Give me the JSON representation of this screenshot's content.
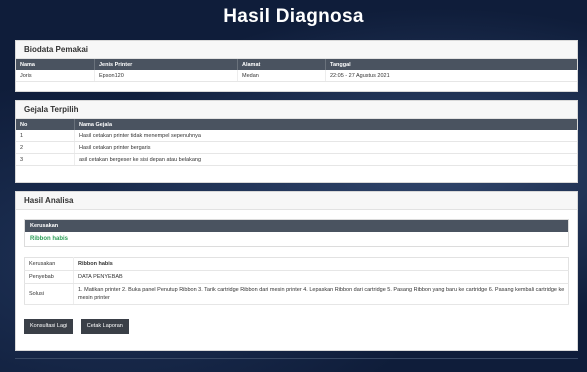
{
  "page": {
    "title": "Hasil Diagnosa"
  },
  "biodata": {
    "heading": "Biodata Pemakai",
    "columns": [
      "Nama",
      "Jenis Printer",
      "Alamat",
      "Tanggal"
    ],
    "row": [
      "Joris",
      "Epson120",
      "Medan",
      "22:05 - 27 Agustus 2021"
    ]
  },
  "gejala": {
    "heading": "Gejala Terpilih",
    "columns": [
      "No",
      "Nama Gejala"
    ],
    "rows": [
      [
        "1",
        "Hasil cetakan printer tidak menempel sepenuhnya"
      ],
      [
        "2",
        "Hasil cetakan printer bergaris"
      ],
      [
        "3",
        "asil cetakan bergeser ke sisi depan atau belakang"
      ]
    ]
  },
  "analisa": {
    "heading": "Hasil Analisa",
    "kerusakan_header": "Kerusakan",
    "kerusakan_value": "Ribbon habis",
    "detail": {
      "kerusakan_label": "Kerusakan",
      "kerusakan_value": "Ribbon habis",
      "penyebab_label": "Penyebab",
      "penyebab_value": "DATA PENYEBAB",
      "solusi_label": "Solusi",
      "solusi_value": "1. Matikan printer 2. Buka panel Penutup Ribbon 3. Tarik cartridge Ribbon dari mesin printer 4. Lepaskan Ribbon dari cartridge 5. Pasang Ribbon yang baru ke cartridge 6. Pasang kembali cartridge ke mesin printer"
    }
  },
  "buttons": {
    "konsultasi": "Konsultasi Lagi",
    "cetak": "Cetak Laporan"
  }
}
